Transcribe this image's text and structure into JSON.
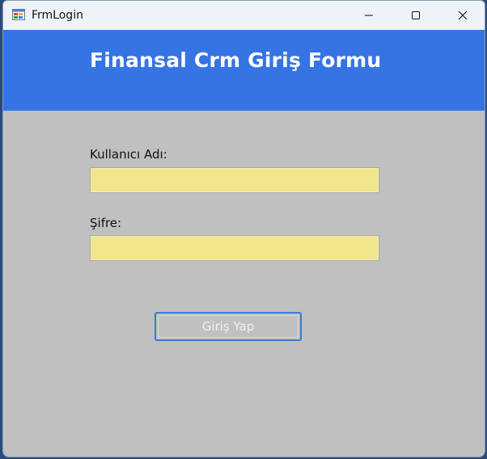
{
  "window": {
    "title": "FrmLogin",
    "app_icon": "winforms-app-icon",
    "controls": {
      "minimize_icon": "minimize-icon",
      "maximize_icon": "maximize-icon",
      "close_icon": "close-icon"
    }
  },
  "header": {
    "title": "Finansal Crm Giriş Formu",
    "background": "#3674e4"
  },
  "form": {
    "username": {
      "label": "Kullanıcı Adı:",
      "value": ""
    },
    "password": {
      "label": "Şifre:",
      "value": ""
    },
    "field_background": "#f0e68c",
    "submit_label": "Giriş Yap"
  },
  "colors": {
    "form_background": "#c0c0c0",
    "button_border": "#3a7bd5"
  }
}
